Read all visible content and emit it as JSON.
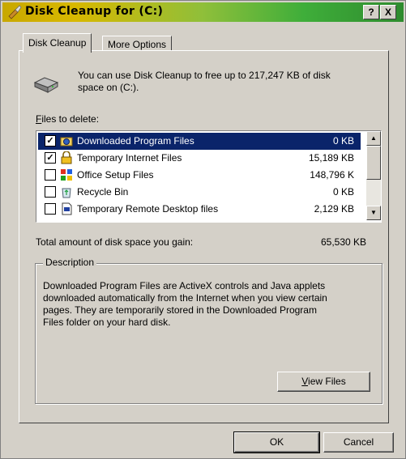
{
  "window": {
    "title": "Disk Cleanup for  (C:)",
    "help_label": "?",
    "close_label": "X"
  },
  "tabs": [
    {
      "label": "Disk Cleanup",
      "active": true
    },
    {
      "label": "More Options",
      "active": false
    }
  ],
  "intro": {
    "text_line1": "You can use Disk Cleanup to free up to 217,247 KB of disk",
    "text_line2": "space on  (C:)."
  },
  "files": {
    "label_prefix": "F",
    "label_rest": "iles to delete:",
    "items": [
      {
        "label": "Downloaded Program Files",
        "size": "0 KB",
        "checked": true,
        "selected": true,
        "icon": "activex-folder-icon"
      },
      {
        "label": "Temporary Internet Files",
        "size": "15,189 KB",
        "checked": true,
        "selected": false,
        "icon": "lock-icon"
      },
      {
        "label": "Office Setup Files",
        "size": "148,796 K",
        "checked": false,
        "selected": false,
        "icon": "office-setup-icon"
      },
      {
        "label": "Recycle Bin",
        "size": "0 KB",
        "checked": false,
        "selected": false,
        "icon": "recycle-bin-icon"
      },
      {
        "label": "Temporary Remote Desktop files",
        "size": "2,129 KB",
        "checked": false,
        "selected": false,
        "icon": "remote-desktop-icon"
      }
    ]
  },
  "total": {
    "label": "Total amount of disk space you gain:",
    "value": "65,530 KB"
  },
  "description": {
    "legend": "Description",
    "lines": [
      "Downloaded Program Files are ActiveX controls and Java applets",
      "downloaded automatically from the Internet when you view certain",
      "pages. They are temporarily stored in the Downloaded Program",
      "Files folder on your hard disk."
    ]
  },
  "buttons": {
    "view_prefix": "V",
    "view_rest": "iew Files",
    "ok": "OK",
    "cancel": "Cancel"
  }
}
